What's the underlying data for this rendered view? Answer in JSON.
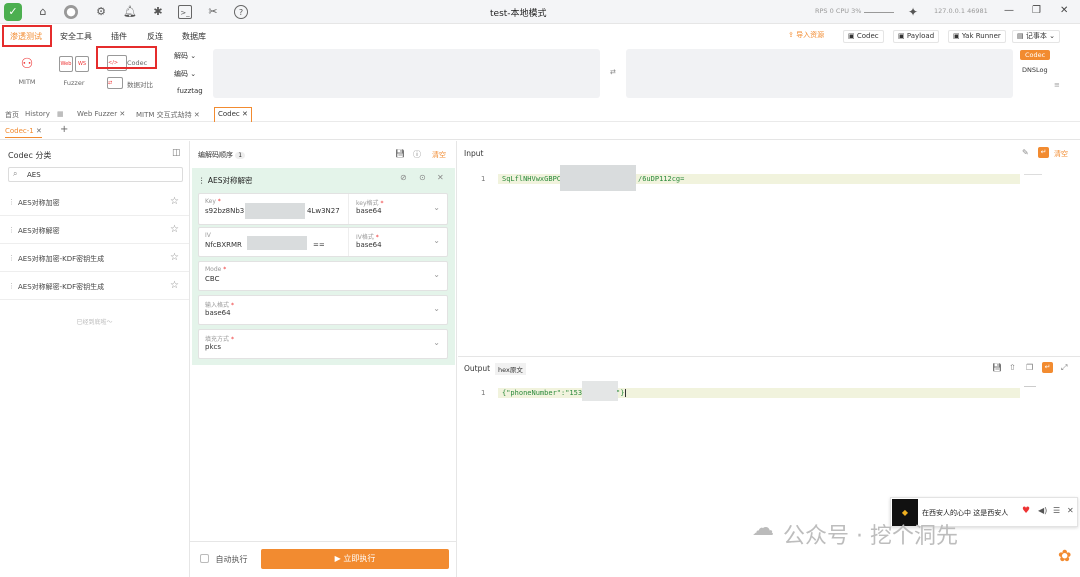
{
  "window": {
    "title": "test-本地模式",
    "rps": "RPS 0  CPU 3%",
    "ip": "127.0.0.1 46981"
  },
  "top_icons": [
    "shield-icon",
    "home-icon",
    "user-icon",
    "gear-icon",
    "bell-icon",
    "bug-icon",
    "terminal-icon",
    "tools-icon",
    "help-icon"
  ],
  "menu": {
    "items": [
      "渗透测试",
      "安全工具",
      "插件",
      "反连",
      "数据库"
    ]
  },
  "right_tools": {
    "import": "导入资源",
    "codec": "Codec",
    "payload": "Payload",
    "yak": "Yak Runner",
    "notebook": "记事本"
  },
  "toolbar": {
    "mitm": "MITM",
    "fuzzer": "Fuzzer",
    "codec": "Codec",
    "compare": "数据对比",
    "decode": "解码",
    "encode": "编码",
    "fuzztag": "fuzztag",
    "side_codec": "Codec",
    "dnslog": "DNSLog"
  },
  "tabs": [
    "首页",
    "History",
    "Web Fuzzer",
    "MITM 交互式劫持",
    "Codec"
  ],
  "subtab": {
    "label": "Codec-1"
  },
  "left": {
    "title": "Codec 分类",
    "search_value": "AES",
    "methods": [
      "AES对称加密",
      "AES对称解密",
      "AES对称加密-KDF密钥生成",
      "AES对称解密-KDF密钥生成"
    ],
    "end_text": "已经到底啦～"
  },
  "middle": {
    "header": "编解码顺序",
    "count": "1",
    "clear": "清空",
    "card_title": "AES对称解密",
    "key_label": "Key",
    "key_value": "s92bz8Nb3",
    "key_tail": "4Lw3N27",
    "key_fmt_label": "key格式",
    "key_fmt_value": "base64",
    "iv_label": "IV",
    "iv_value": "NfcBXRMR",
    "iv_tail": "==",
    "iv_fmt_label": "IV格式",
    "iv_fmt_value": "base64",
    "mode_label": "Mode",
    "mode_value": "CBC",
    "input_fmt_label": "输入格式",
    "input_fmt_value": "base64",
    "padding_label": "填充方式",
    "padding_value": "pkcs",
    "auto_label": "自动执行",
    "run_label": "立即执行"
  },
  "input": {
    "label": "Input",
    "clear": "清空",
    "line_no": "1",
    "text_head": "SqLflNHVwxGBPC",
    "text_tail": "/6uDP112cg="
  },
  "output": {
    "label": "Output",
    "tag": "hex原文",
    "line_no": "1",
    "text_head": "{\"phoneNumber\":\"153",
    "text_tail": "\"}"
  },
  "video": {
    "text": "在西安人的心中 这是西安人"
  },
  "watermark": {
    "text": "公众号 · 挖个洞先"
  }
}
